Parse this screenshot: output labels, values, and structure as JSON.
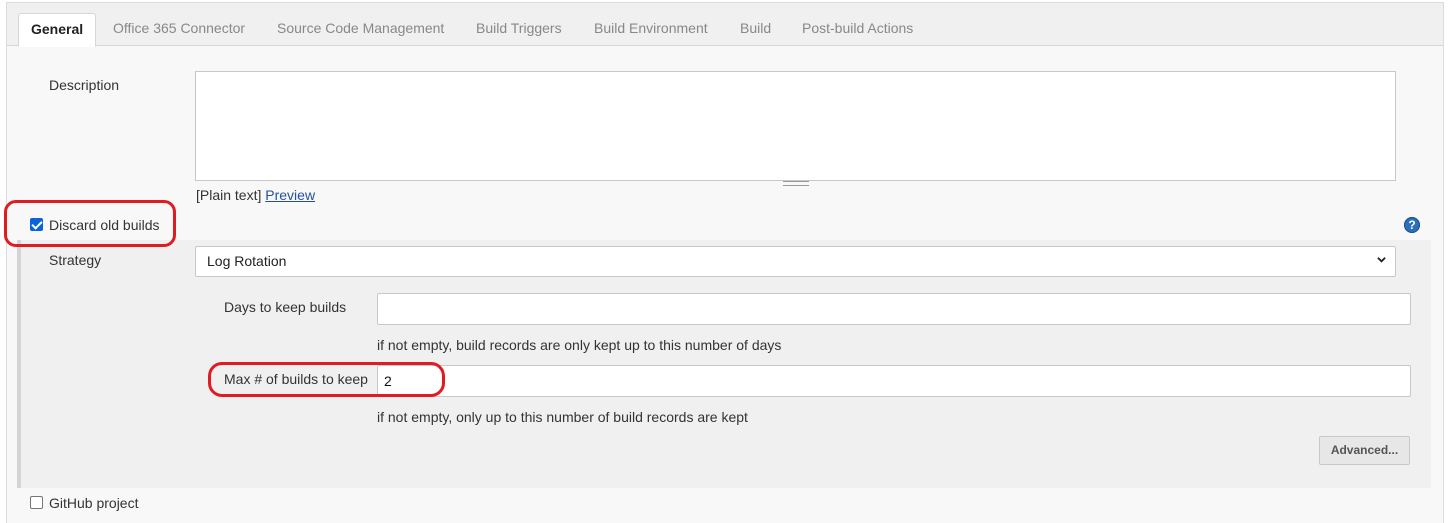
{
  "tabs": [
    {
      "label": "General",
      "active": true
    },
    {
      "label": "Office 365 Connector",
      "active": false
    },
    {
      "label": "Source Code Management",
      "active": false
    },
    {
      "label": "Build Triggers",
      "active": false
    },
    {
      "label": "Build Environment",
      "active": false
    },
    {
      "label": "Build",
      "active": false
    },
    {
      "label": "Post-build Actions",
      "active": false
    }
  ],
  "description": {
    "label": "Description",
    "value": "",
    "format_prefix": "[Plain text]",
    "preview_link": "Preview"
  },
  "discard_old_builds": {
    "label": "Discard old builds",
    "checked": true,
    "help_icon": "question-mark-icon",
    "strategy_label": "Strategy",
    "strategy_value": "Log Rotation",
    "days_label": "Days to keep builds",
    "days_value": "",
    "days_help": "if not empty, build records are only kept up to this number of days",
    "max_label": "Max # of builds to keep",
    "max_value": "2",
    "max_help": "if not empty, only up to this number of build records are kept",
    "advanced_button": "Advanced..."
  },
  "github_project": {
    "label": "GitHub project",
    "checked": false
  },
  "colors": {
    "highlight_annotation": "#e11b22",
    "link": "#24519c",
    "checkbox_accent": "#0a64d8"
  }
}
